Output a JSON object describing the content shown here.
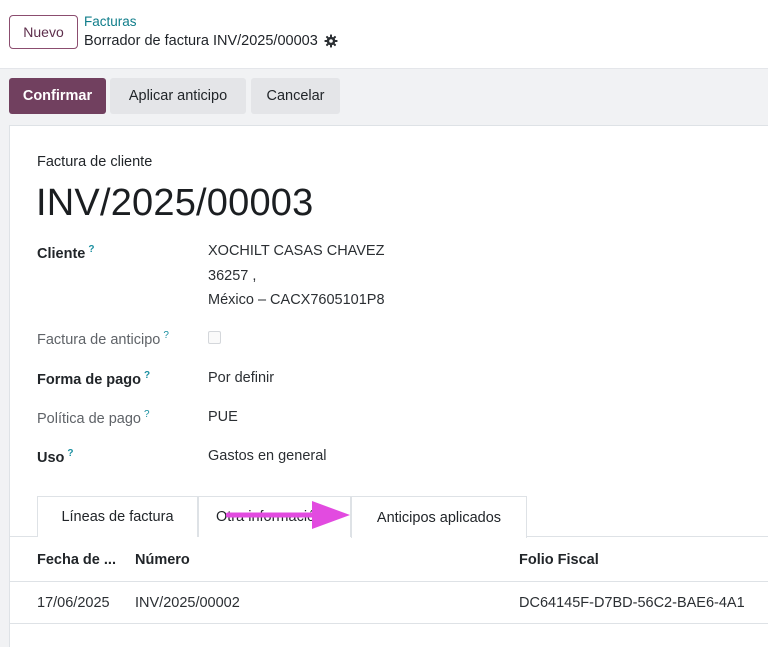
{
  "header": {
    "new_button": "Nuevo",
    "breadcrumb_parent": "Facturas",
    "breadcrumb_current": "Borrador de factura INV/2025/00003"
  },
  "actions": {
    "confirm": "Confirmar",
    "apply_advance": "Aplicar anticipo",
    "cancel": "Cancelar"
  },
  "form": {
    "doc_type": "Factura de cliente",
    "doc_name": "INV/2025/00003",
    "fields": {
      "cliente": {
        "label": "Cliente",
        "lines": [
          "XOCHILT CASAS CHAVEZ",
          "36257 ,",
          "México – CACX7605101P8"
        ]
      },
      "factura_anticipo": {
        "label": "Factura de anticipo",
        "checked": false
      },
      "forma_pago": {
        "label": "Forma de pago",
        "value": "Por definir"
      },
      "politica_pago": {
        "label": "Política de pago",
        "value": "PUE"
      },
      "uso": {
        "label": "Uso",
        "value": "Gastos en general"
      }
    },
    "help_mark": "?"
  },
  "tabs": [
    {
      "label": "Líneas de factura",
      "active": false
    },
    {
      "label": "Otra información",
      "active": false
    },
    {
      "label": "Anticipos aplicados",
      "active": true
    }
  ],
  "table": {
    "headers": [
      "Fecha de ...",
      "Número",
      "Folio Fiscal"
    ],
    "rows": [
      [
        "17/06/2025",
        "INV/2025/00002",
        "DC64145F-D7BD-56C2-BAE6-4A1"
      ]
    ]
  },
  "colors": {
    "primary": "#71405f",
    "link": "#0f7d8a",
    "help": "#1a8fa0",
    "annotation_arrow": "#e24be0"
  },
  "icons": [
    "gear-icon",
    "arrow-annotation"
  ]
}
